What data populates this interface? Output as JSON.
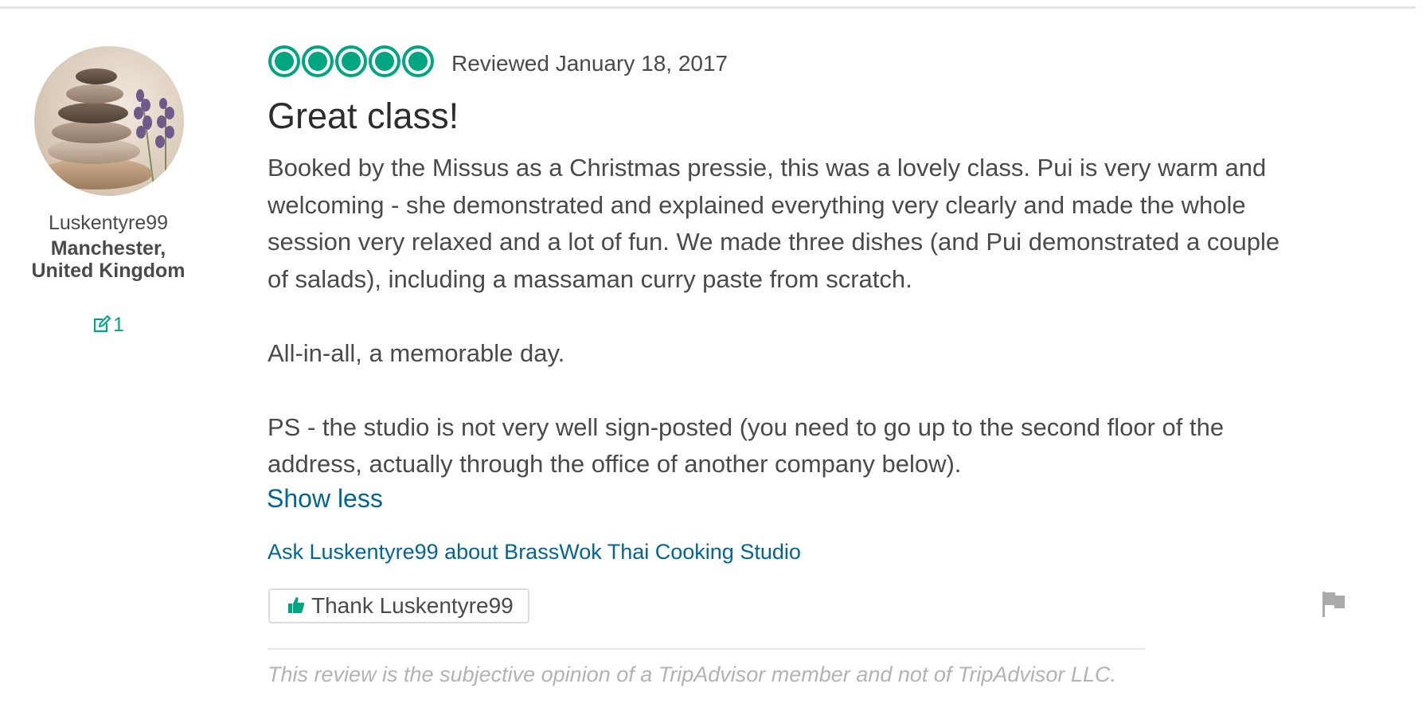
{
  "reviewer": {
    "username": "Luskentyre99",
    "location": "Manchester, United Kingdom",
    "contributions": "1",
    "avatar_icon": "stacked-stones-lavender-avatar",
    "contribution_icon": "pencil-edit-icon"
  },
  "review": {
    "rating": 5,
    "rating_max": 5,
    "date": "Reviewed January 18, 2017",
    "title": "Great class!",
    "paragraphs": [
      "Booked by the Missus as a Christmas pressie, this was a lovely class. Pui is very warm and welcoming - she demonstrated and explained everything very clearly and made the whole session very relaxed and a lot of fun. We made three dishes (and Pui demonstrated a couple of salads), including a massaman curry paste from scratch.",
      "All-in-all, a memorable day.",
      "PS - the studio is not very well sign-posted (you need to go up to the second floor of the address, actually through the office of another company below)."
    ],
    "show_less_label": "Show less",
    "ask_label": "Ask Luskentyre99 about BrassWok Thai Cooking Studio",
    "thank_label": "Thank Luskentyre99",
    "disclaimer": "This review is the subjective opinion of a TripAdvisor member and not of TripAdvisor LLC."
  },
  "colors": {
    "brand_green": "#00a680",
    "link_blue": "#006699",
    "text": "#4a4a4a",
    "muted": "#b3b3b3"
  },
  "icons": {
    "thank": "thumbs-up-icon",
    "report": "flag-icon"
  }
}
